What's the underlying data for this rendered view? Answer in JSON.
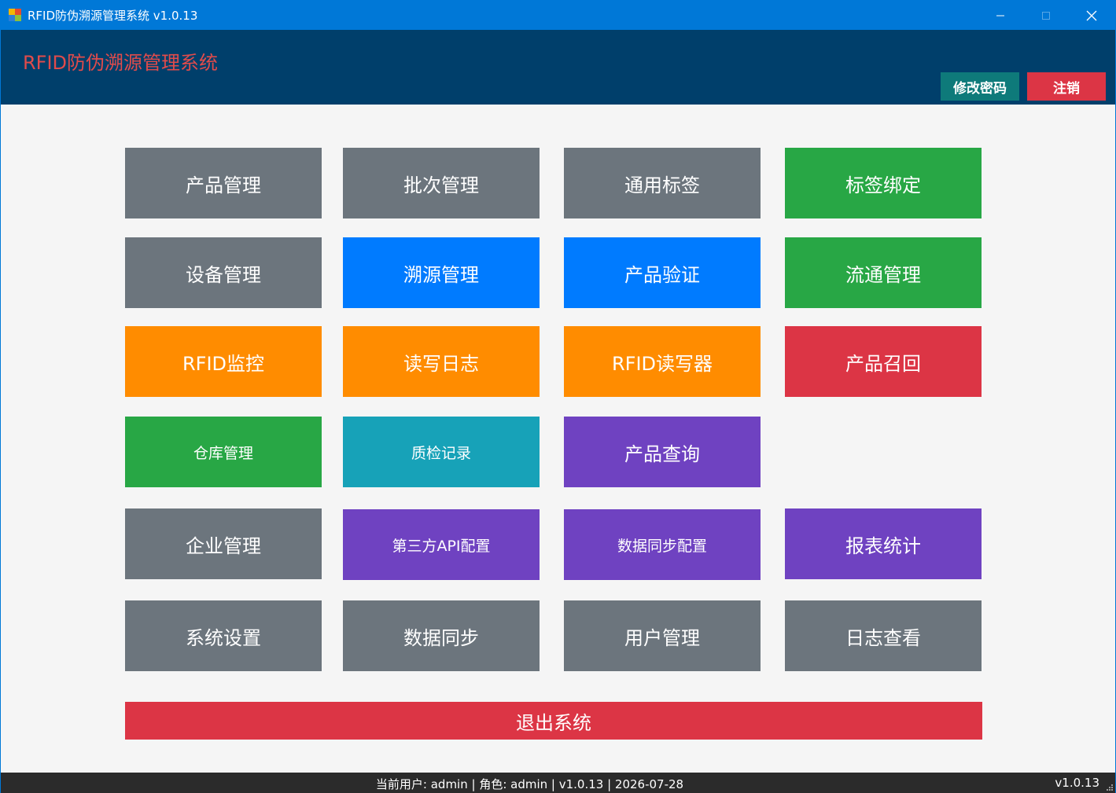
{
  "window": {
    "title": "RFID防伪溯源管理系统 v1.0.13",
    "minimize_icon": "minimize-icon",
    "maximize_icon": "maximize-icon",
    "close_icon": "close-icon"
  },
  "header": {
    "title": "RFID防伪溯源管理系统",
    "change_password": "修改密码",
    "logout": "注销"
  },
  "tiles": {
    "r1": [
      "产品管理",
      "批次管理",
      "通用标签",
      "标签绑定"
    ],
    "r2": [
      "设备管理",
      "溯源管理",
      "产品验证",
      "流通管理"
    ],
    "r3": [
      "RFID监控",
      "读写日志",
      "RFID读写器",
      "产品召回"
    ],
    "r4": [
      "仓库管理",
      "质检记录",
      "产品查询"
    ],
    "r5": [
      "企业管理",
      "第三方API配置",
      "数据同步配置",
      "报表统计"
    ],
    "r6": [
      "系统设置",
      "数据同步",
      "用户管理",
      "日志查看"
    ]
  },
  "exit_label": "退出系统",
  "status": {
    "center": "当前用户: admin | 角色: admin | v1.0.13 | 2026-07-28",
    "version": "v1.0.13"
  },
  "colors": {
    "titlebar": "#0078d7",
    "header": "#003f6b",
    "gray": "#6c757d",
    "green": "#28a745",
    "blue": "#007bff",
    "orange": "#ff8c00",
    "red": "#dc3545",
    "teal": "#17a2b8",
    "purple": "#6f42c1"
  }
}
